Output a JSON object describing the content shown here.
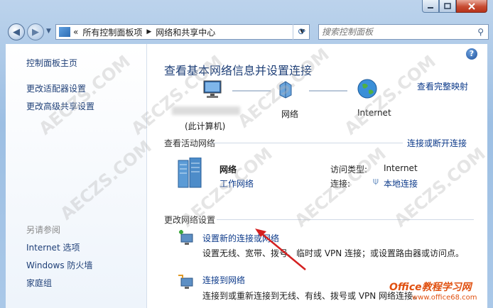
{
  "address": {
    "segments": [
      "所有控制面板项",
      "网络和共享中心"
    ],
    "chevron": "«"
  },
  "search": {
    "placeholder": "搜索控制面板"
  },
  "sidebar": {
    "links": [
      "控制面板主页",
      "更改适配器设置",
      "更改高级共享设置"
    ],
    "see_also_title": "另请参阅",
    "see_also": [
      "Internet 选项",
      "Windows 防火墙",
      "家庭组"
    ]
  },
  "main": {
    "title": "查看基本网络信息并设置连接",
    "full_map": "查看完整映射",
    "map": {
      "computer_label": "(此计算机)",
      "network_label": "网络",
      "internet_label": "Internet"
    },
    "active_title": "查看活动网络",
    "connect_disconnect": "连接或断开连接",
    "network_name": "网络",
    "network_type": "工作网络",
    "access_type_label": "访问类型:",
    "access_type_value": "Internet",
    "connection_label": "连接:",
    "connection_value": "本地连接",
    "change_title": "更改网络设置",
    "task1_title": "设置新的连接或网络",
    "task1_desc": "设置无线、宽带、拨号、临时或 VPN 连接；或设置路由器或访问点。",
    "task2_title": "连接到网络",
    "task2_desc": "连接到或重新连接到无线、有线、拨号或 VPN 网络连接。"
  },
  "watermarks": {
    "text": "AECZS.COM",
    "site_logo": "Office教程学习网",
    "site_url": "www.office68.com"
  },
  "colors": {
    "link": "#0c3a8a",
    "heading": "#1e3f77",
    "arrow": "#d42020"
  }
}
